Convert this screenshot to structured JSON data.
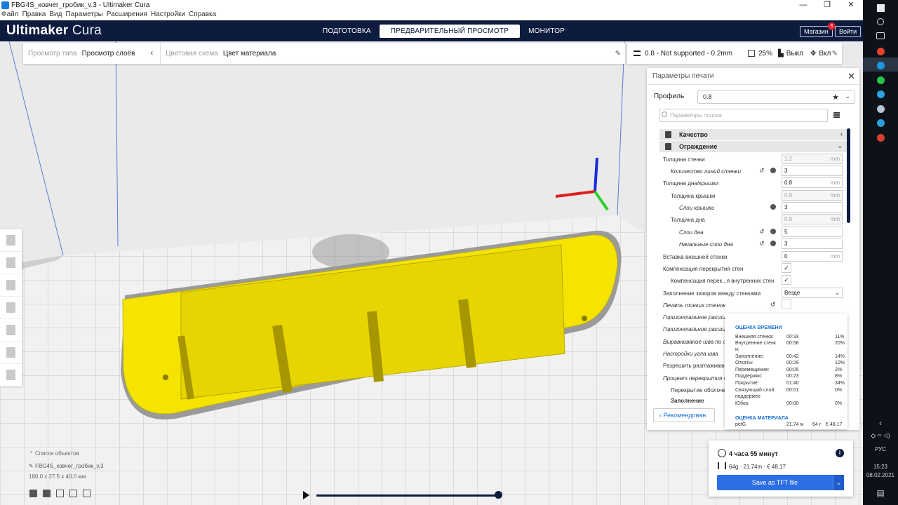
{
  "window": {
    "title": "FBG4S_ковчег_гробик_v.3 - Ultimaker Cura",
    "controls": [
      "—",
      "❐",
      "✕"
    ]
  },
  "menu": [
    "Файл",
    "Правка",
    "Вид",
    "Параметры",
    "Расширения",
    "Настройки",
    "Справка"
  ],
  "header": {
    "brand_bold": "Ultimaker",
    "brand_light": " Cura",
    "stages": [
      "ПОДГОТОВКА",
      "ПРЕДВАРИТЕЛЬНЫЙ ПРОСМОТР",
      "МОНИТОР"
    ],
    "active_stage": "ПРЕДВАРИТЕЛЬНЫЙ ПРОСМОТР",
    "marketplace": "Магазин",
    "marketplace_badge": "3",
    "signin": "Войти"
  },
  "stagebar": {
    "view_type_label": "Просмотр типа",
    "view_type_value": "Просмотр слоёв",
    "color_scheme_label": "Цветовая схема",
    "color_scheme_value": "Цвет материала"
  },
  "print_setup_bar": {
    "profile": "0.8 - Not supported - 0.2mm",
    "infill": "25%",
    "support": "Выкл",
    "adhesion": "Вкл"
  },
  "settings": {
    "title": "Параметры печати",
    "profile_label": "Профиль",
    "profile_value": "0.8",
    "search_placeholder": "Параметры поиска",
    "categories": [
      {
        "label": "Качество"
      },
      {
        "label": "Ограждение"
      }
    ],
    "rows": [
      {
        "label": "Толщина стенки",
        "value": "1.2",
        "unit": "mm",
        "disabled": true
      },
      {
        "label": "Количество линий стенки",
        "value": "3"
      },
      {
        "label": "Толщина дна/крышки",
        "value": "0.8",
        "unit": "mm"
      },
      {
        "label": "Толщина крышки",
        "value": "0.8",
        "unit": "mm",
        "disabled": true
      },
      {
        "label": "Слои крышки",
        "value": "3"
      },
      {
        "label": "Толщина дна",
        "value": "0.8",
        "unit": "mm",
        "disabled": true
      },
      {
        "label": "Слои дна",
        "value": "5"
      },
      {
        "label": "Начальные слои дна",
        "value": "3"
      },
      {
        "label": "Вставка внешней стенки",
        "value": "0",
        "unit": "mm"
      },
      {
        "label": "Компенсация перекрытия стен",
        "check": "✓"
      },
      {
        "label": "Компенсация перек...я внутренних стен",
        "check": "✓"
      },
      {
        "label": "Заполнение зазоров между стенками",
        "value": "Везде"
      },
      {
        "label": "Печать тонких стенок"
      },
      {
        "label": "Горизонтальное расши"
      },
      {
        "label": "Горизонтальное расшире"
      },
      {
        "label": "Выравнивание шва по ос"
      },
      {
        "label": "Настройки угла шва"
      },
      {
        "label": "Разрешить разглаживан"
      },
      {
        "label": "Процент перекрытия об"
      },
      {
        "label": "Перекрытие оболочк"
      },
      {
        "label": "Заполнение"
      }
    ],
    "recommended_button": "Рекомендован"
  },
  "estimate": {
    "time_title": "ОЦЕНКА ВРЕМЕНИ",
    "time_rows": [
      {
        "name": "Внешняя стенка:",
        "time": "00:33",
        "pct": "11%"
      },
      {
        "name": "Внутренние стенк",
        "time": "00:58",
        "pct": "20%"
      },
      {
        "name": "и:",
        "time": "",
        "pct": ""
      },
      {
        "name": "Заполнение:",
        "time": "00:42",
        "pct": "14%"
      },
      {
        "name": "Откаты:",
        "time": "00:29",
        "pct": "10%"
      },
      {
        "name": "Перемещение:",
        "time": "00:05",
        "pct": "2%"
      },
      {
        "name": "Поддержки:",
        "time": "00:23",
        "pct": "8%"
      },
      {
        "name": "Покрытие:",
        "time": "01:40",
        "pct": "34%"
      },
      {
        "name": "Связующий слой",
        "time": "00:01",
        "pct": "0%"
      },
      {
        "name": "поддержек:",
        "time": "",
        "pct": ""
      },
      {
        "name": "Юбка:",
        "time": "00:00",
        "pct": "0%"
      }
    ],
    "material_title": "ОЦЕНКА МАТЕРИАЛА",
    "material_rows": [
      {
        "name": "petG",
        "length": "21.74 м",
        "weight": "64 г",
        "cost": "€ 48.17"
      }
    ]
  },
  "output": {
    "print_time": "4 часа 55 минут",
    "material_summary": "64g · 21.74m · € 48.17",
    "save_button": "Save as TFT file",
    "info_icon": "i"
  },
  "object_list": {
    "header": "Список объектов",
    "object_name": "FBG4S_ковчег_гробик_v.3",
    "dimensions": "180.0 x 27.5 x 40.0 мм"
  },
  "layer_slider": {
    "position": 1.0
  },
  "taskbar": {
    "lang": "РУС",
    "time": "15:23",
    "date": "08.02.2021"
  },
  "colors": {
    "header_bg": "#0c1b3e",
    "accent_blue": "#2c6ee6",
    "model_yellow": "#f5e400",
    "x_axis": "#e01e1e",
    "y_axis": "#2ad02a",
    "z_axis": "#1a2ae0"
  }
}
